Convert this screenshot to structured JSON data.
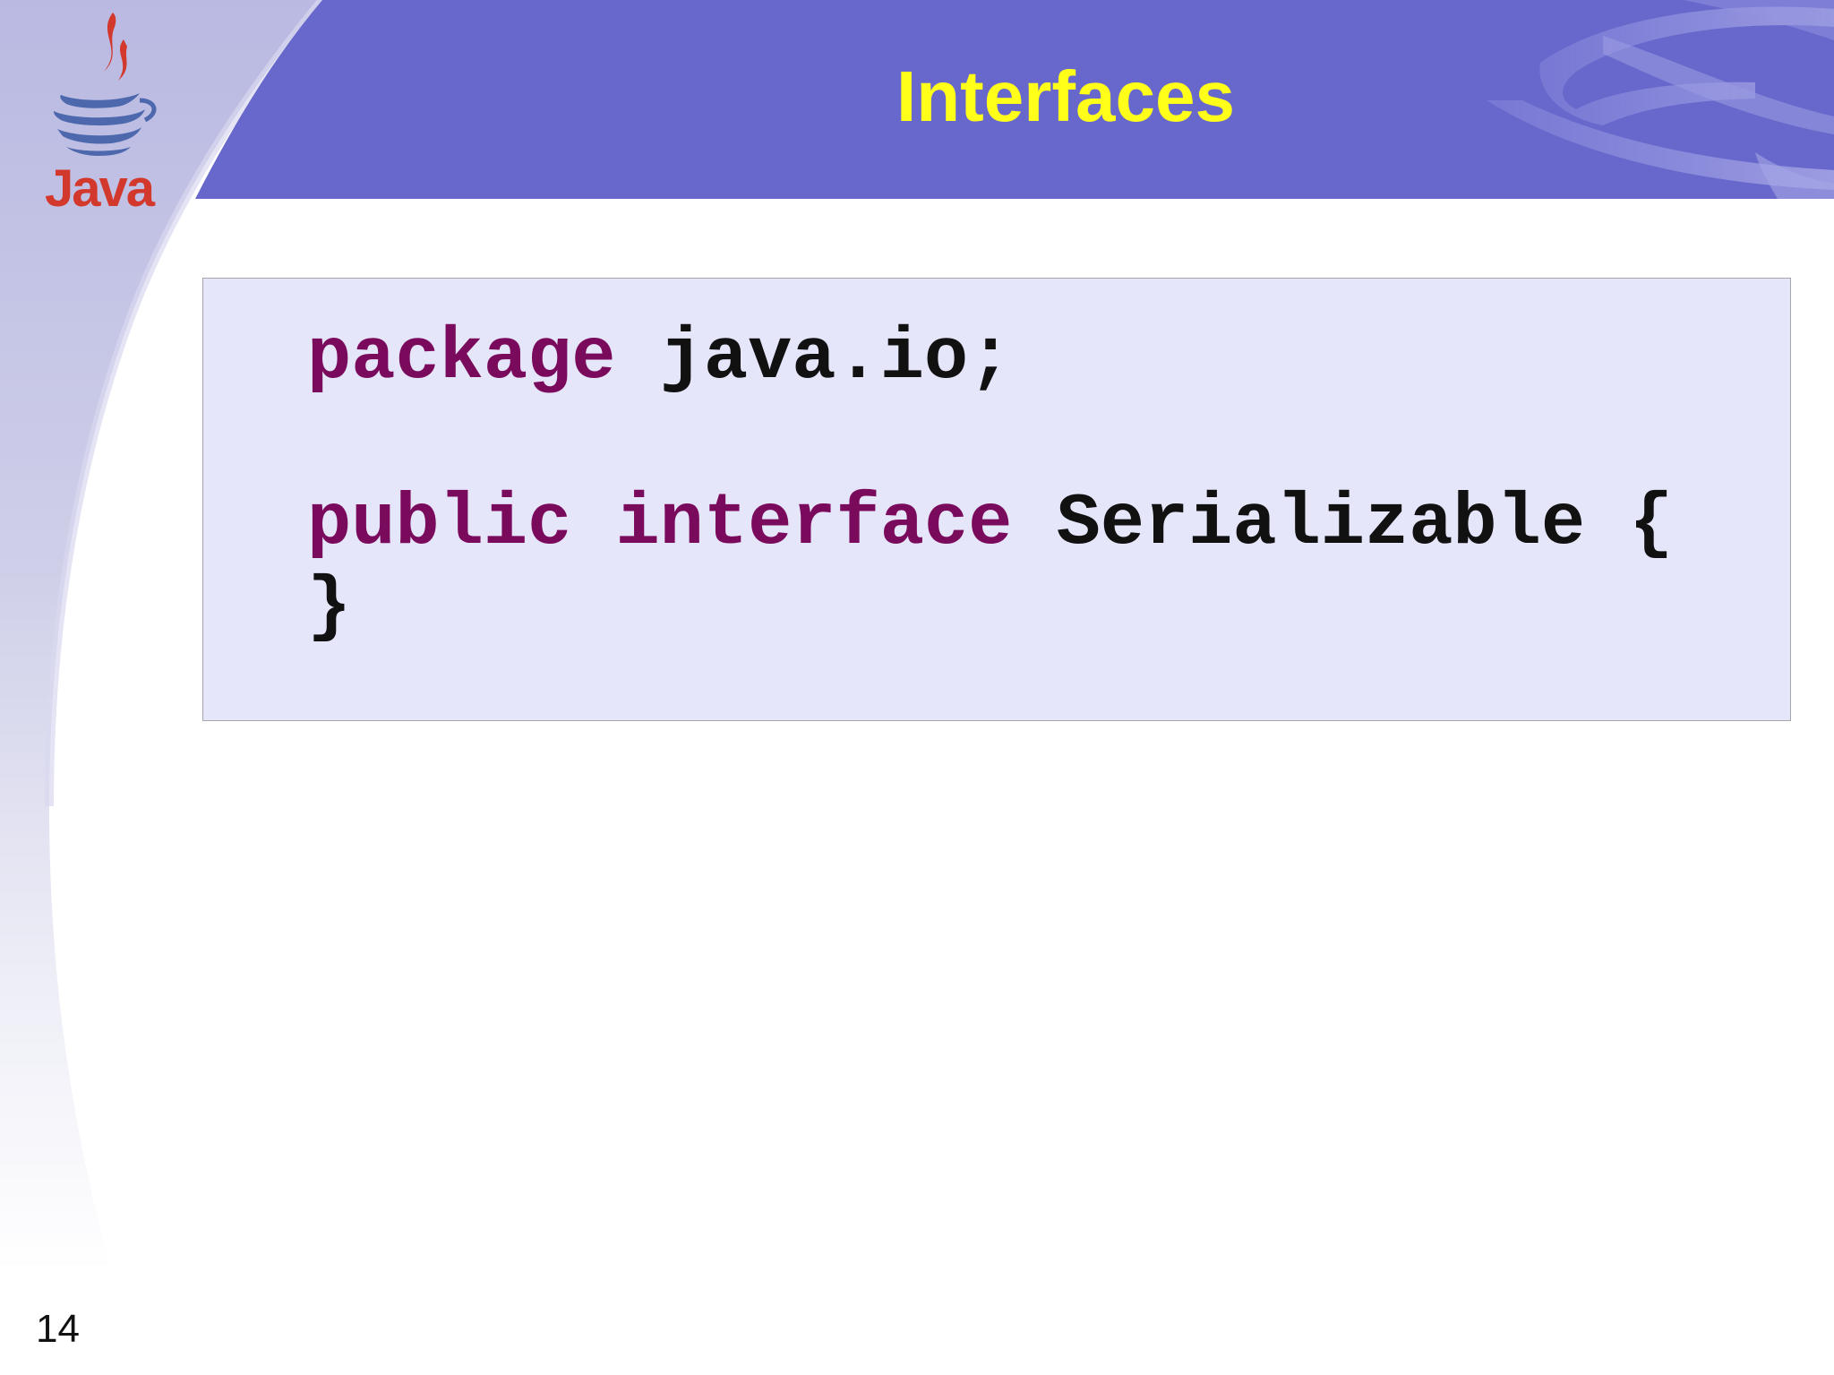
{
  "slide": {
    "title": "Interfaces",
    "page_number": "14",
    "logo_text": "Java"
  },
  "code": {
    "line1": {
      "keyword": "package",
      "rest": "java.io;"
    },
    "line2": {
      "keyword1": "public",
      "keyword2": "interface",
      "rest": "Serializable {"
    },
    "line3": "}"
  },
  "colors": {
    "header_band": "#6868cc",
    "title": "#ffff1a",
    "code_background": "#e6e6fb",
    "code_border": "#a6a6ad",
    "keyword": "#7a0a5c",
    "code_text": "#111111",
    "logo_red": "#d2382b",
    "logo_blue": "#4d68ac"
  },
  "icons": {
    "logo": "java-coffee-cup-logo"
  }
}
